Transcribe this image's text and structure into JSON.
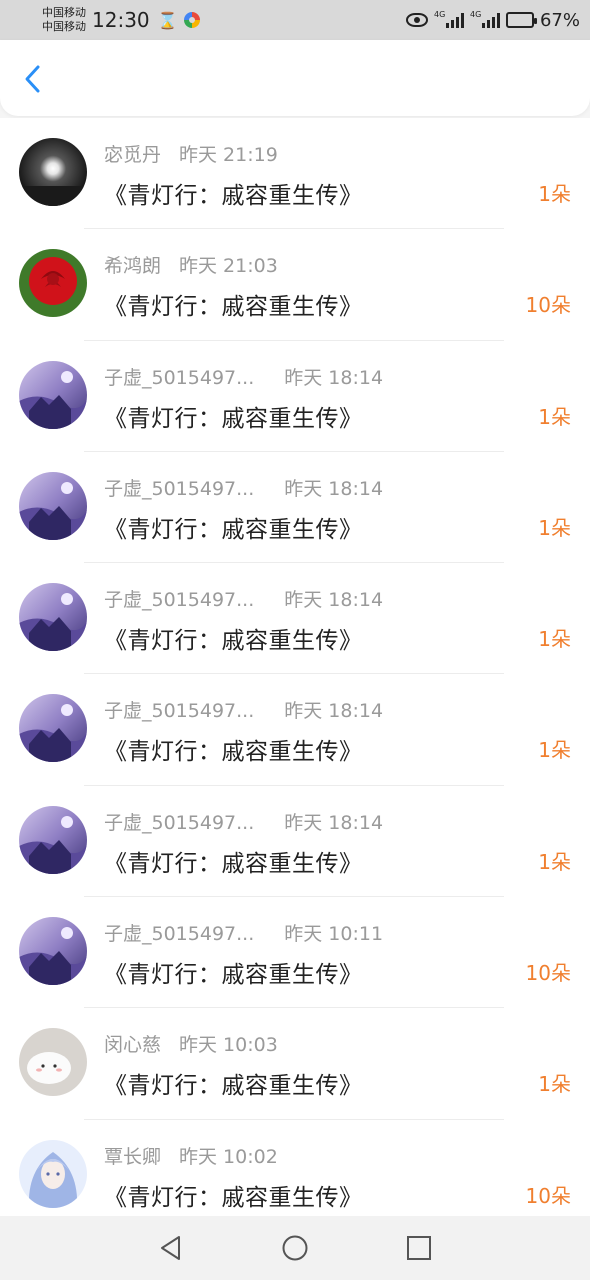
{
  "status": {
    "carrier1": "中国移动",
    "carrier2": "中国移动",
    "time": "12:30",
    "signal_tag1": "4G",
    "signal_tag2": "4G",
    "battery_percent": "67%",
    "battery_level": 0.67
  },
  "records": [
    {
      "name": "宓觅丹",
      "time": "昨天 21:19",
      "title": "《青灯行：戚容重生传》",
      "flowers": "1朵",
      "avatar": "moon"
    },
    {
      "name": "希鸿朗",
      "time": "昨天 21:03",
      "title": "《青灯行：戚容重生传》",
      "flowers": "10朵",
      "avatar": "rose"
    },
    {
      "name": "子虚_5015497...",
      "time": "昨天 18:14",
      "title": "《青灯行：戚容重生传》",
      "flowers": "1朵",
      "avatar": "landscape"
    },
    {
      "name": "子虚_5015497...",
      "time": "昨天 18:14",
      "title": "《青灯行：戚容重生传》",
      "flowers": "1朵",
      "avatar": "landscape"
    },
    {
      "name": "子虚_5015497...",
      "time": "昨天 18:14",
      "title": "《青灯行：戚容重生传》",
      "flowers": "1朵",
      "avatar": "landscape"
    },
    {
      "name": "子虚_5015497...",
      "time": "昨天 18:14",
      "title": "《青灯行：戚容重生传》",
      "flowers": "1朵",
      "avatar": "landscape"
    },
    {
      "name": "子虚_5015497...",
      "time": "昨天 18:14",
      "title": "《青灯行：戚容重生传》",
      "flowers": "1朵",
      "avatar": "landscape"
    },
    {
      "name": "子虚_5015497...",
      "time": "昨天 10:11",
      "title": "《青灯行：戚容重生传》",
      "flowers": "10朵",
      "avatar": "landscape"
    },
    {
      "name": "闵心慈",
      "time": "昨天 10:03",
      "title": "《青灯行：戚容重生传》",
      "flowers": "1朵",
      "avatar": "mochi"
    },
    {
      "name": "覃长卿",
      "time": "昨天 10:02",
      "title": "《青灯行：戚容重生传》",
      "flowers": "10朵",
      "avatar": "anime"
    }
  ],
  "colors": {
    "accent_back": "#2a8ff7",
    "flower_orange": "#f07f2f"
  }
}
